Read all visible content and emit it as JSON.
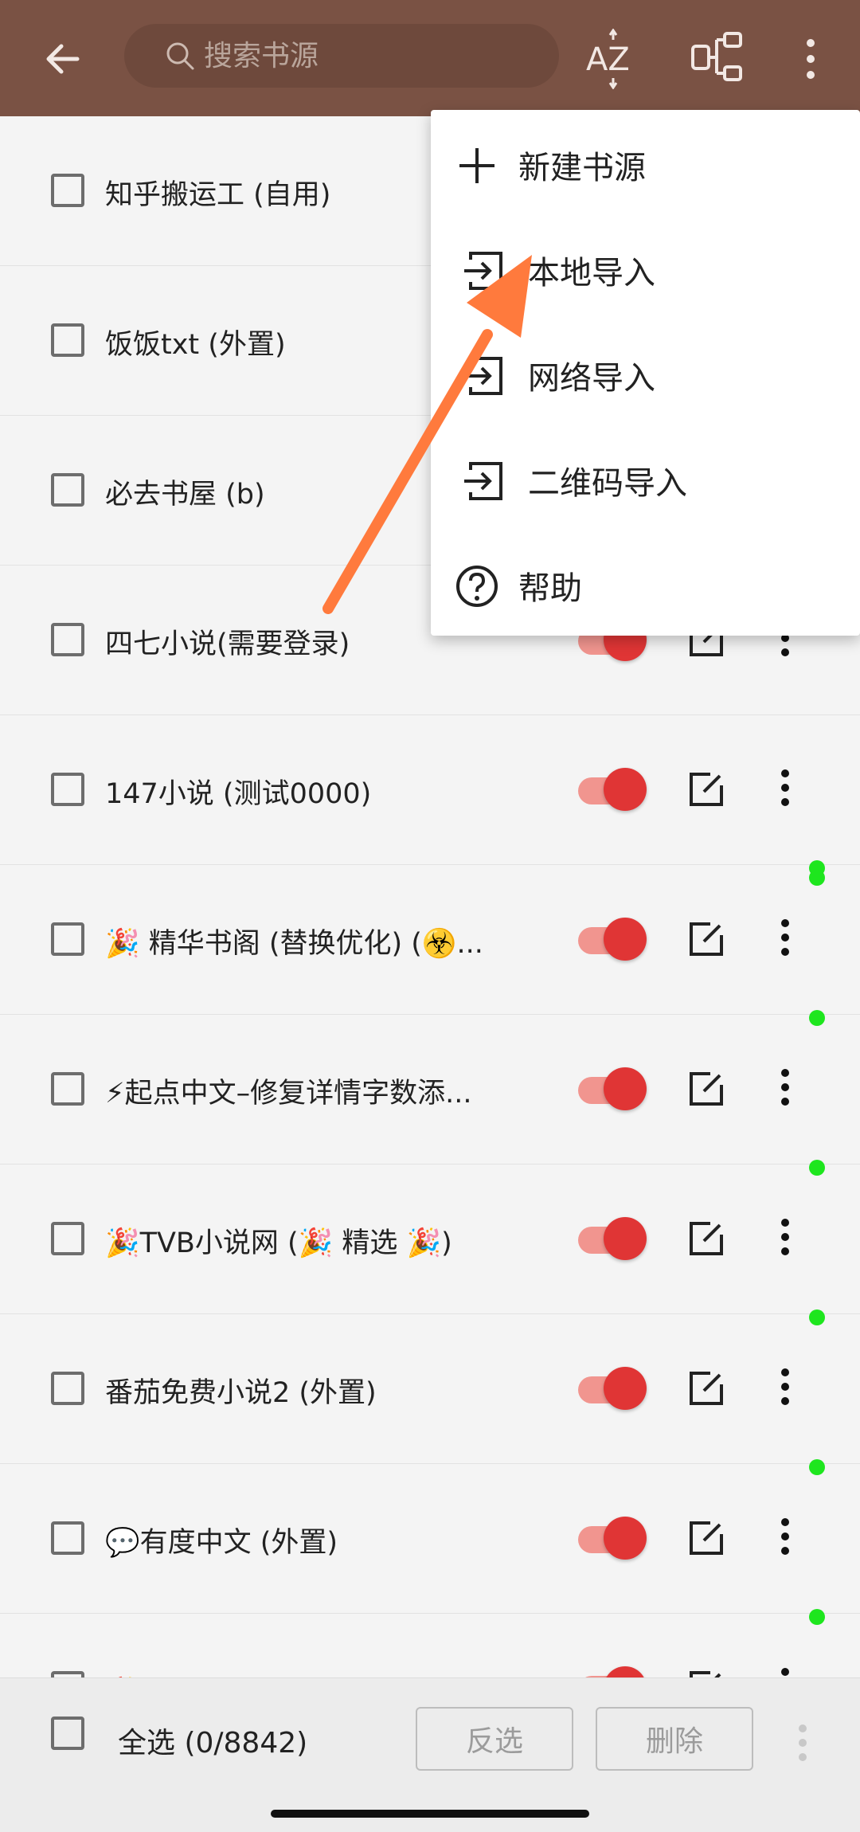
{
  "search": {
    "placeholder": "搜索书源"
  },
  "colors": {
    "appbar": "#7a5244",
    "switch_on": "#e03535",
    "status_dot": "#1ee61e",
    "arrow": "#ff7a3d"
  },
  "icons": {
    "back": "arrow-left-icon",
    "search": "search-icon",
    "sort": "sort-az-icon",
    "group": "group-icon",
    "more": "more-vertical-icon"
  },
  "rows": [
    {
      "label": "知乎搬运工 (自用)"
    },
    {
      "label": "饭饭txt (外置)"
    },
    {
      "label": "必去书屋 (b)"
    },
    {
      "label": "四七小说(需要登录)"
    },
    {
      "label": "147小说 (测试0000)"
    },
    {
      "label": "🎉 精华书阁 (替换优化) (☣️..."
    },
    {
      "label": "⚡起点中文–修复详情字数添..."
    },
    {
      "label": "🎉TVB小说网 (🎉 精选 🎉)"
    },
    {
      "label": "番茄免费小说2 (外置)"
    },
    {
      "label": "💬有度中文 (外置)"
    },
    {
      "label": "🎉 番茄 (西红柿) 小说 (搜索"
    }
  ],
  "menu": {
    "items": [
      {
        "label": "新建书源",
        "icon": "plus-icon"
      },
      {
        "label": "本地导入",
        "icon": "import-icon"
      },
      {
        "label": "网络导入",
        "icon": "import-icon"
      },
      {
        "label": "二维码导入",
        "icon": "import-icon"
      },
      {
        "label": "帮助",
        "icon": "help-circle-icon"
      }
    ]
  },
  "bottom": {
    "select_all": "全选 (0/8842)",
    "invert": "反选",
    "delete": "删除"
  }
}
